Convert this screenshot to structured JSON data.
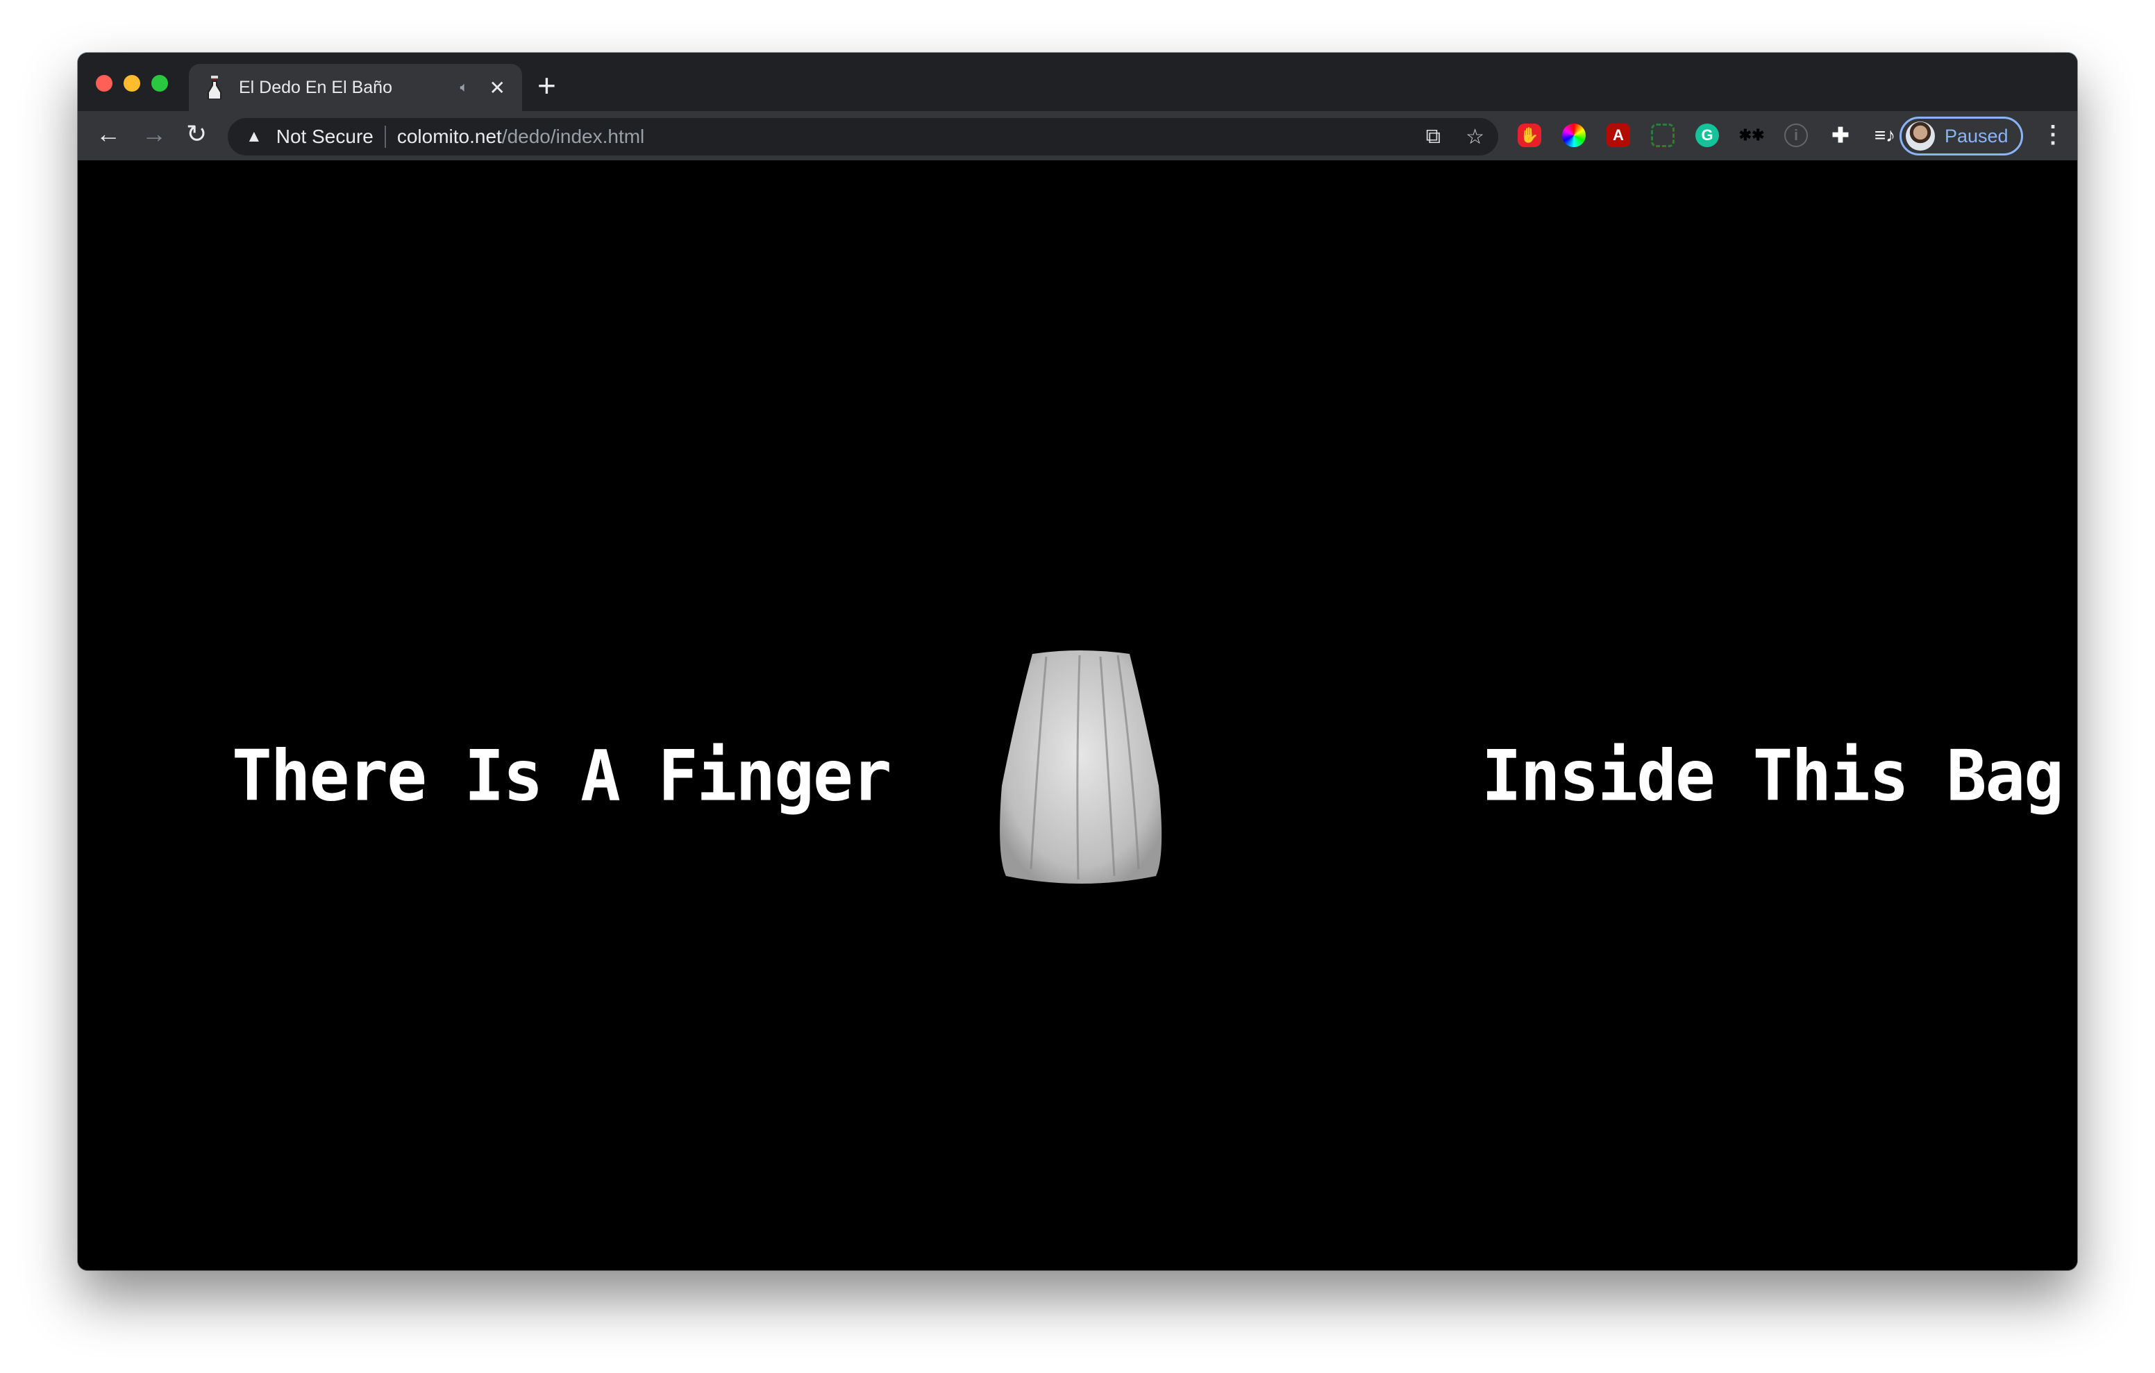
{
  "browser": {
    "tab": {
      "title": "El Dedo En El Baño",
      "favicon": "pixel-bottle-icon",
      "audio_icon": "speaker-icon",
      "close_icon": "close-icon"
    },
    "new_tab_icon": "plus-icon",
    "address": {
      "security_label": "Not Secure",
      "host": "colomito.net",
      "path": "/dedo/index.html"
    },
    "profile": {
      "label": "Paused"
    },
    "colors": {
      "tabbar": "#202124",
      "toolbar": "#35363a",
      "accent": "#8ab4f8"
    },
    "extensions": [
      "adblock-icon",
      "color-picker-icon",
      "acrobat-icon",
      "screenshot-icon",
      "grammarly-icon",
      "eyes-icon",
      "info-icon",
      "puzzle-icon",
      "media-queue-icon"
    ]
  },
  "page": {
    "left_text": "There Is A Finger",
    "right_text": "Inside This Bag",
    "image": "cloth-bag"
  }
}
